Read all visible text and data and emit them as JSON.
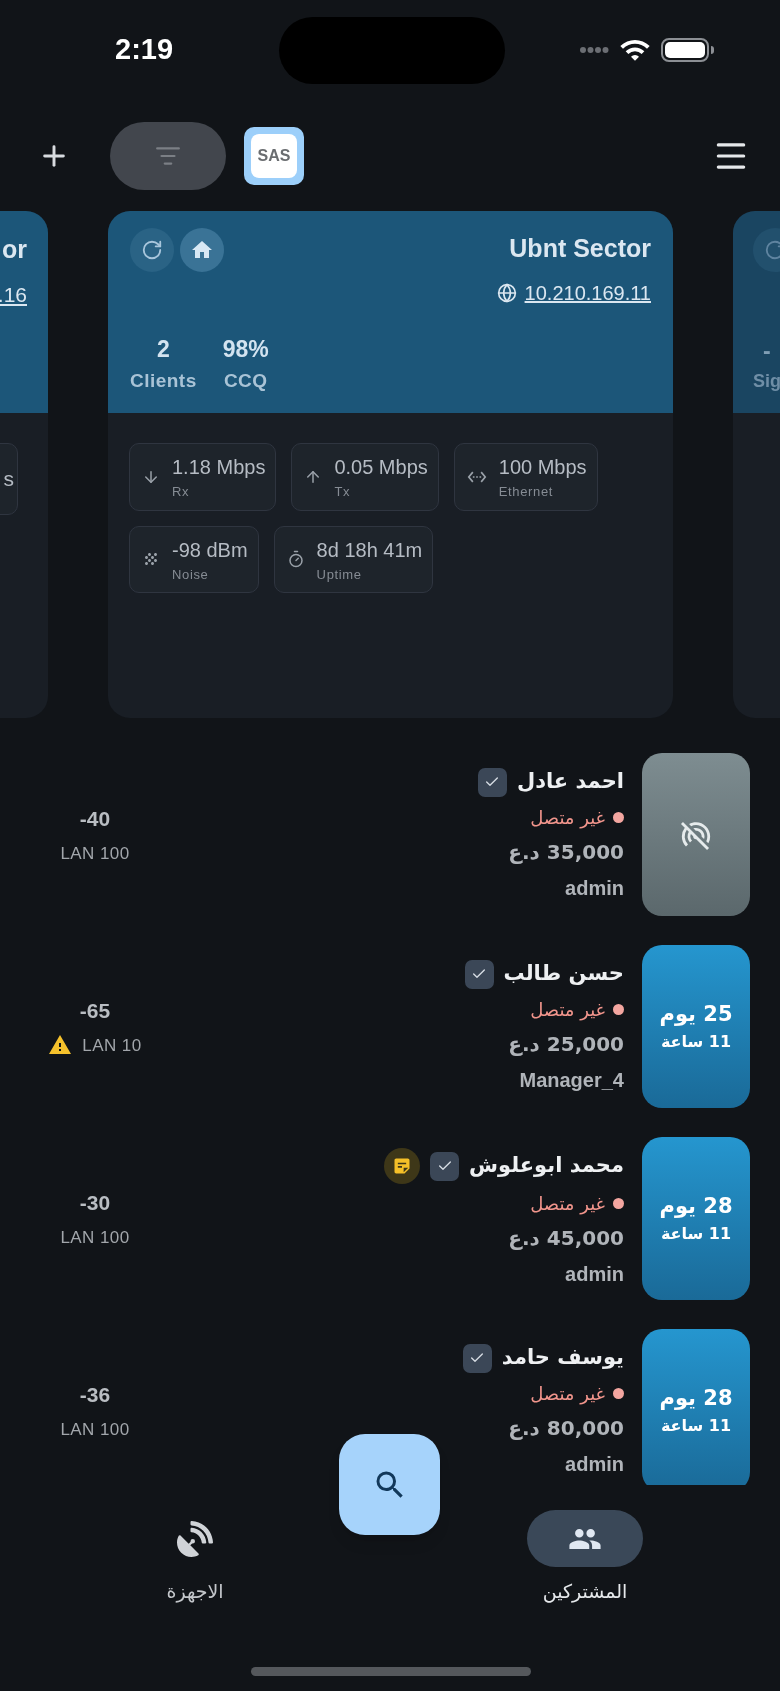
{
  "status_bar": {
    "time": "2:19"
  },
  "toolbar": {
    "logo_text": "SAS"
  },
  "left_card": {
    "title": "or",
    "ip": ".16",
    "chip_text": "s"
  },
  "main_card": {
    "title": "Ubnt Sector",
    "ip": "10.210.169.11",
    "stats": [
      {
        "value": "98%",
        "label": "CCQ"
      },
      {
        "value": "2",
        "label": "Clients"
      }
    ],
    "metric_rows": [
      [
        {
          "kind": "ethernet",
          "value": "100 Mbps",
          "label": "Ethernet"
        },
        {
          "kind": "tx",
          "value": "0.05 Mbps",
          "label": "Tx"
        },
        {
          "kind": "rx",
          "value": "1.18 Mbps",
          "label": "Rx"
        }
      ],
      [
        {
          "kind": "uptime",
          "value": "8d 18h 41m",
          "label": "Uptime"
        },
        {
          "kind": "noise",
          "value": "-98 dBm",
          "label": "Noise"
        }
      ]
    ]
  },
  "right_card": {
    "stat_value": "-",
    "stat_label": "Sig"
  },
  "subscribers": [
    {
      "name": "احمد عادل",
      "checked": true,
      "note": false,
      "status": "غير متصل",
      "price": "35,000 د.ع",
      "user": "admin",
      "tile": {
        "kind": "offline"
      },
      "signal": "-40",
      "link": "LAN 100",
      "warning": false
    },
    {
      "name": "حسن طالب",
      "checked": true,
      "note": false,
      "status": "غير متصل",
      "price": "25,000 د.ع",
      "user": "Manager_4",
      "tile": {
        "kind": "remaining",
        "days": "25 يوم",
        "hours": "11 ساعة"
      },
      "signal": "-65",
      "link": "LAN 10",
      "warning": true
    },
    {
      "name": "محمد ابوعلوش",
      "checked": true,
      "note": true,
      "status": "غير متصل",
      "price": "45,000 د.ع",
      "user": "admin",
      "tile": {
        "kind": "remaining",
        "days": "28 يوم",
        "hours": "11 ساعة"
      },
      "signal": "-30",
      "link": "LAN 100",
      "warning": false
    },
    {
      "name": "يوسف حامد",
      "checked": true,
      "note": false,
      "status": "غير متصل",
      "price": "80,000 د.ع",
      "user": "admin",
      "tile": {
        "kind": "remaining",
        "days": "28 يوم",
        "hours": "11 ساعة"
      },
      "signal": "-36",
      "link": "LAN 100",
      "warning": false
    }
  ],
  "bottom_nav": [
    {
      "kind": "subscribers",
      "label": "المشتركين",
      "selected": true
    },
    {
      "kind": "devices",
      "label": "الاجهزة",
      "selected": false
    }
  ]
}
